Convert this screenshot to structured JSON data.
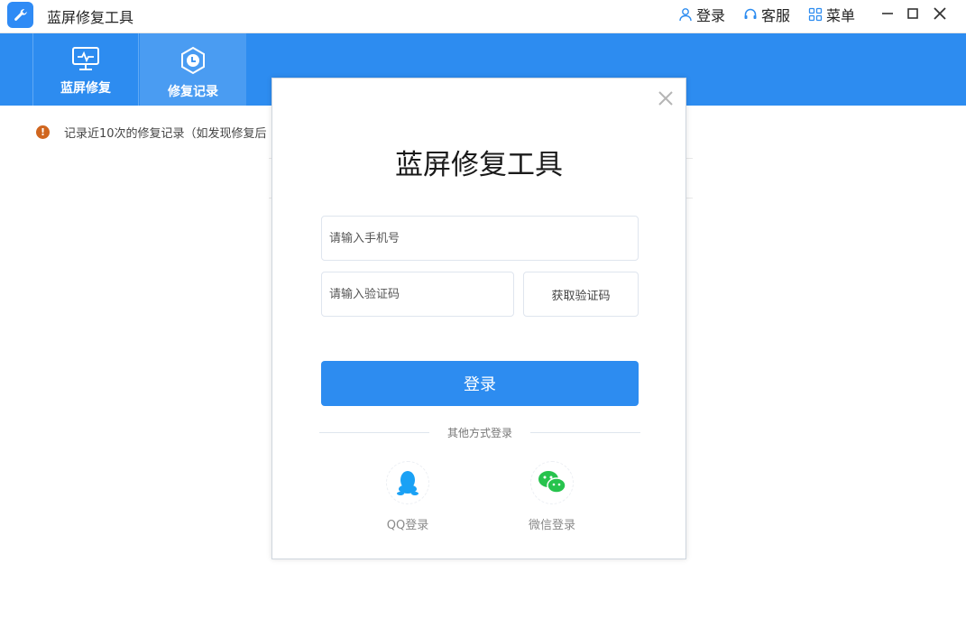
{
  "app": {
    "title": "蓝屏修复工具"
  },
  "header_actions": {
    "login": "登录",
    "service": "客服",
    "menu": "菜单"
  },
  "nav": [
    {
      "label": "蓝屏修复",
      "icon": "monitor-icon"
    },
    {
      "label": "修复记录",
      "icon": "clock-hexagon-icon",
      "active": true
    }
  ],
  "info": {
    "text": "记录近10次的修复记录（如发现修复后"
  },
  "modal": {
    "title": "蓝屏修复工具",
    "phone_placeholder": "请输入手机号",
    "code_placeholder": "请输入验证码",
    "get_code": "获取验证码",
    "login_button": "登录",
    "other_login": "其他方式登录",
    "qq_label": "QQ登录",
    "wechat_label": "微信登录"
  },
  "colors": {
    "brand": "#2d8cf0",
    "warning": "#d0661f",
    "qq": "#1aa1f5",
    "wechat": "#27c34d"
  }
}
